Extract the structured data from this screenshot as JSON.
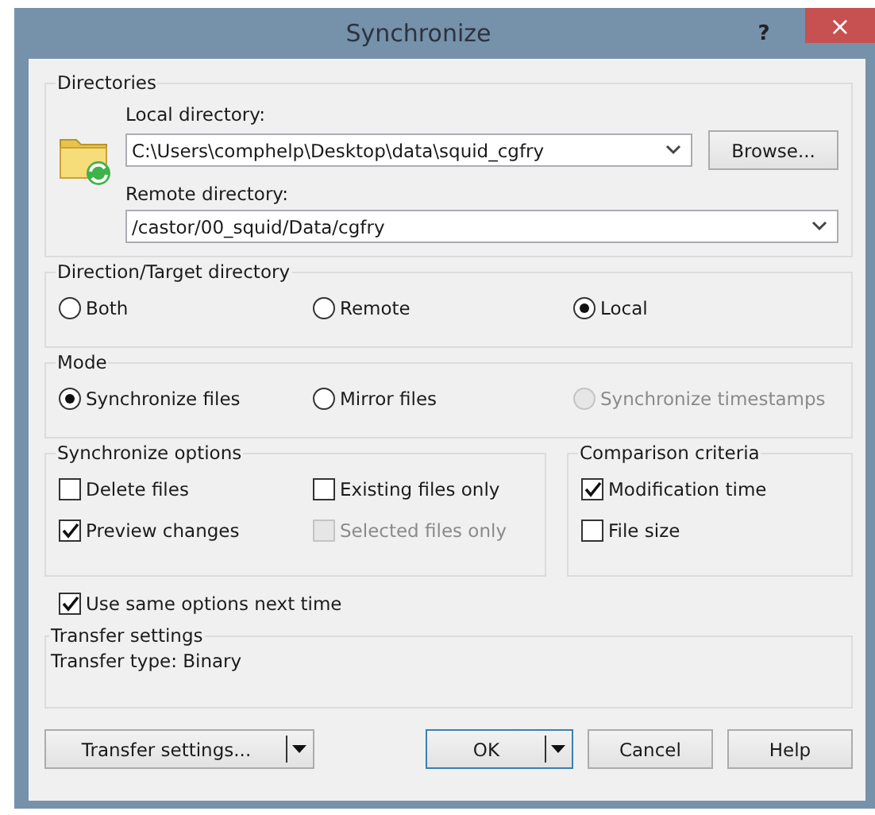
{
  "window": {
    "title": "Synchronize",
    "help_button": "?",
    "close_button": "×"
  },
  "directories": {
    "title": "Directories",
    "local_label": "Local directory:",
    "local_value": "C:\\Users\\comphelp\\Desktop\\data\\squid_cgfry",
    "browse_button": "Browse...",
    "remote_label": "Remote directory:",
    "remote_value": "/castor/00_squid/Data/cgfry"
  },
  "direction": {
    "title": "Direction/Target directory",
    "options": [
      {
        "label": "Both",
        "selected": false,
        "disabled": false
      },
      {
        "label": "Remote",
        "selected": false,
        "disabled": false
      },
      {
        "label": "Local",
        "selected": true,
        "disabled": false
      }
    ]
  },
  "mode": {
    "title": "Mode",
    "options": [
      {
        "label": "Synchronize files",
        "selected": true,
        "disabled": false
      },
      {
        "label": "Mirror files",
        "selected": false,
        "disabled": false
      },
      {
        "label": "Synchronize timestamps",
        "selected": false,
        "disabled": true
      }
    ]
  },
  "synchronize_options": {
    "title": "Synchronize options",
    "items": [
      {
        "label": "Delete files",
        "checked": false,
        "disabled": false
      },
      {
        "label": "Existing files only",
        "checked": false,
        "disabled": false
      },
      {
        "label": "Preview changes",
        "checked": true,
        "disabled": false
      },
      {
        "label": "Selected files only",
        "checked": false,
        "disabled": true
      }
    ]
  },
  "comparison_criteria": {
    "title": "Comparison criteria",
    "items": [
      {
        "label": "Modification time",
        "checked": true,
        "disabled": false
      },
      {
        "label": "File size",
        "checked": false,
        "disabled": false
      }
    ]
  },
  "use_same_options": {
    "label": "Use same options next time",
    "checked": true
  },
  "transfer_settings": {
    "title": "Transfer settings",
    "text": "Transfer type: Binary"
  },
  "buttons": [
    {
      "label": "Transfer settings...",
      "kind": "split",
      "default": false
    },
    {
      "label": "OK",
      "kind": "split",
      "default": true
    },
    {
      "label": "Cancel",
      "kind": "plain",
      "default": false
    },
    {
      "label": "Help",
      "kind": "plain",
      "default": false
    }
  ]
}
